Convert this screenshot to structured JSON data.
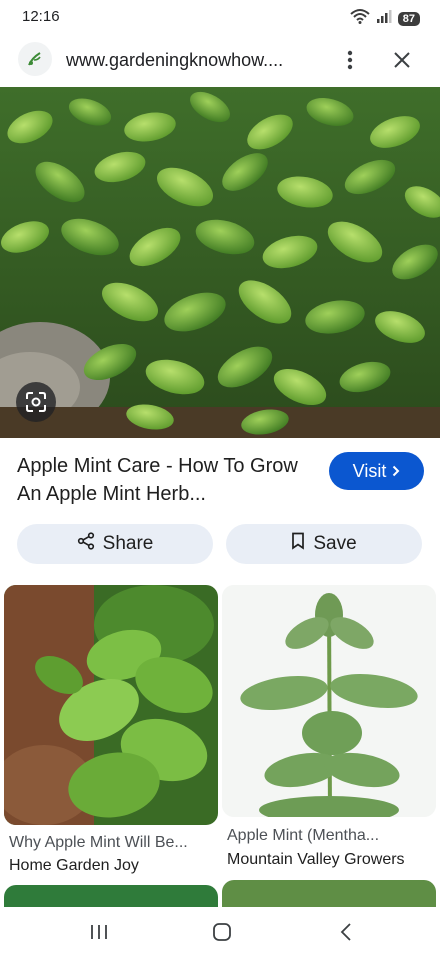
{
  "status_bar": {
    "time": "12:16",
    "battery": "87",
    "wifi_label": "5",
    "icons": [
      "wifi-icon",
      "signal-icon",
      "battery-icon"
    ]
  },
  "browser": {
    "url": "www.gardeningknowhow....",
    "favicon": "gardening-know-how-logo",
    "menu_icon": "more-vert-icon",
    "close_icon": "close-icon"
  },
  "hero_image": {
    "subject": "apple mint plants",
    "lens_icon": "google-lens-icon"
  },
  "result": {
    "title": "Apple Mint Care - How To Grow An Apple Mint Herb...",
    "visit_label": "Visit",
    "share_label": "Share",
    "save_label": "Save"
  },
  "related": [
    {
      "title": "Why Apple Mint Will Be...",
      "source": "Home Garden Joy"
    },
    {
      "title": "Apple Mint (Mentha...",
      "source": "Mountain Valley Growers"
    }
  ],
  "nav": {
    "icons": [
      "recent-apps-icon",
      "home-icon",
      "back-icon"
    ]
  },
  "colors": {
    "accent": "#0b57d0",
    "pill_bg": "#e9eef6",
    "leaf_dark": "#2f6b1f",
    "leaf_light": "#8cc63f"
  }
}
